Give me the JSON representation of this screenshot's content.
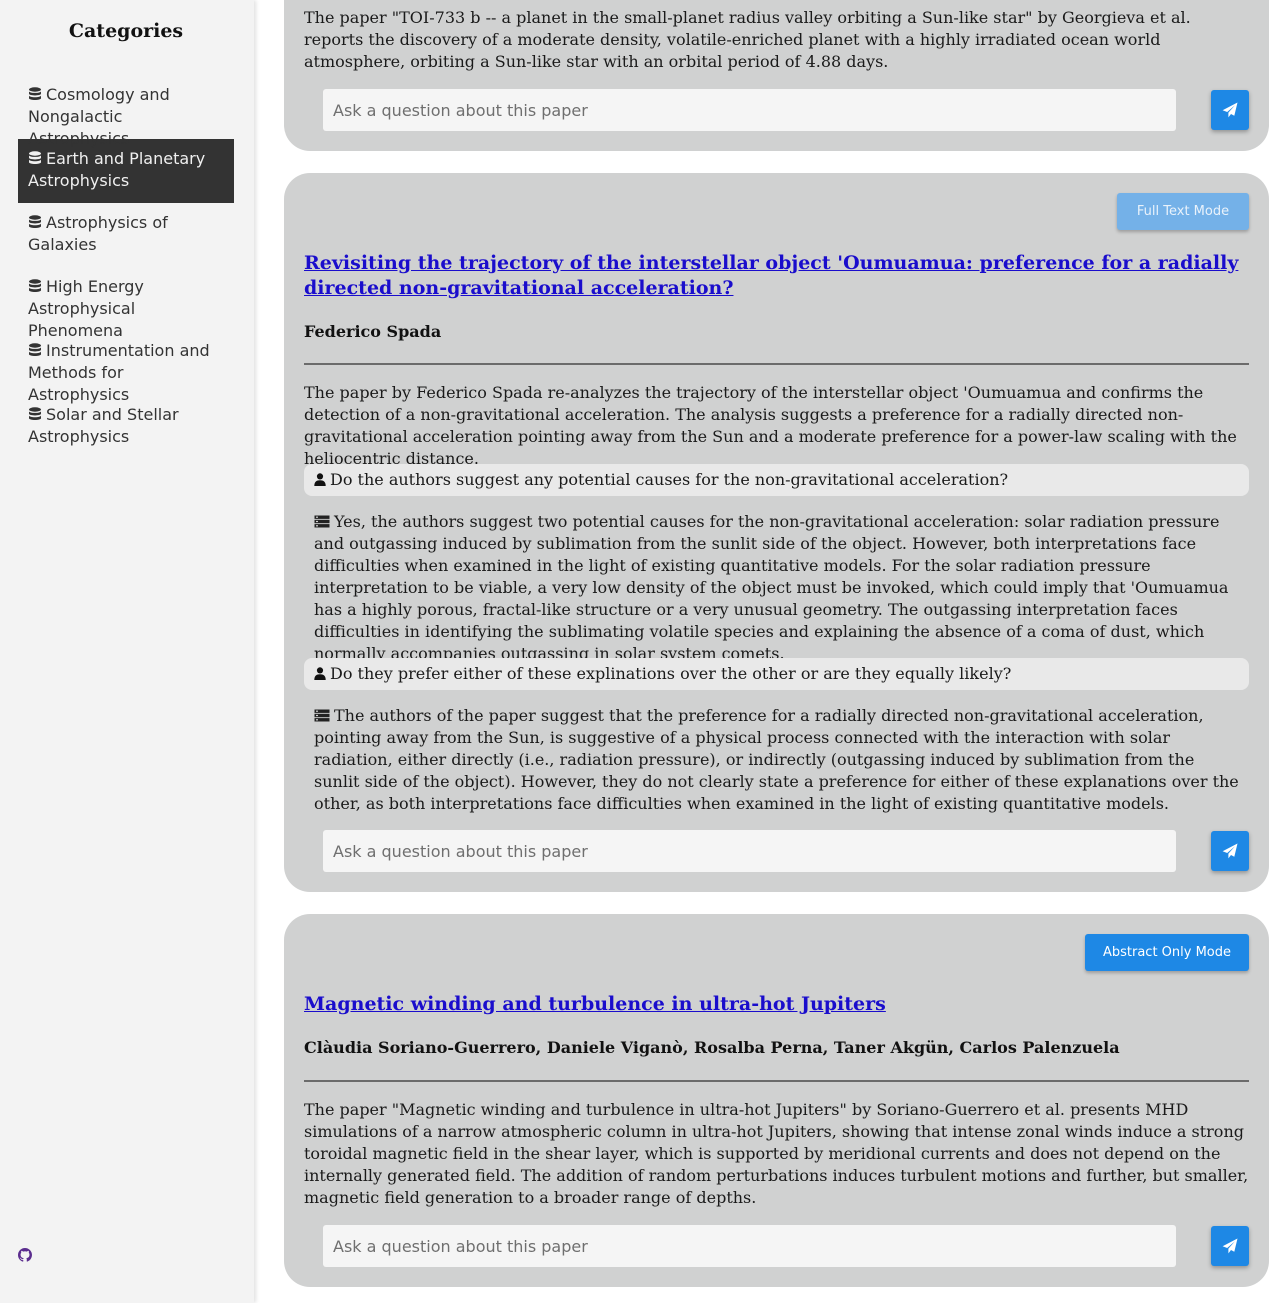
{
  "sidebar": {
    "title": "Categories",
    "items": [
      {
        "label": "Cosmology and Nongalactic Astrophysics",
        "active": false
      },
      {
        "label": "Earth and Planetary Astrophysics",
        "active": true
      },
      {
        "label": "Astrophysics of Galaxies",
        "active": false
      },
      {
        "label": "High Energy Astrophysical Phenomena",
        "active": false
      },
      {
        "label": "Instrumentation and Methods for Astrophysics",
        "active": false
      },
      {
        "label": "Solar and Stellar Astrophysics",
        "active": false
      }
    ],
    "footer_icon": "github-icon"
  },
  "papers": [
    {
      "summary": "The paper \"TOI-733 b -- a planet in the small-planet radius valley orbiting a Sun-like star\" by Georgieva et al. reports the discovery of a moderate density, volatile-enriched planet with a highly irradiated ocean world atmosphere, orbiting a Sun-like star with an orbital period of 4.88 days.",
      "ask_placeholder": "Ask a question about this paper"
    },
    {
      "mode_button": "Full Text Mode",
      "title": "Revisiting the trajectory of the interstellar object 'Oumuamua: preference for a radially directed non-gravitational acceleration?",
      "authors": "Federico Spada",
      "summary": "The paper by Federico Spada re-analyzes the trajectory of the interstellar object 'Oumuamua and confirms the detection of a non-gravitational acceleration. The analysis suggests a preference for a radially directed non-gravitational acceleration pointing away from the Sun and a moderate preference for a power-law scaling with the heliocentric distance.",
      "qa": [
        {
          "question": "Do the authors suggest any potential causes for the non-gravitational acceleration?",
          "answer": "Yes, the authors suggest two potential causes for the non-gravitational acceleration: solar radiation pressure and outgassing induced by sublimation from the sunlit side of the object. However, both interpretations face difficulties when examined in the light of existing quantitative models. For the solar radiation pressure interpretation to be viable, a very low density of the object must be invoked, which could imply that 'Oumuamua has a highly porous, fractal-like structure or a very unusual geometry. The outgassing interpretation faces difficulties in identifying the sublimating volatile species and explaining the absence of a coma of dust, which normally accompanies outgassing in solar system comets."
        },
        {
          "question": "Do they prefer either of these explinations over the other or are they equally likely?",
          "answer": "The authors of the paper suggest that the preference for a radially directed non-gravitational acceleration, pointing away from the Sun, is suggestive of a physical process connected with the interaction with solar radiation, either directly (i.e., radiation pressure), or indirectly (outgassing induced by sublimation from the sunlit side of the object). However, they do not clearly state a preference for either of these explanations over the other, as both interpretations face difficulties when examined in the light of existing quantitative models."
        }
      ],
      "ask_placeholder": "Ask a question about this paper"
    },
    {
      "mode_button": "Abstract Only Mode",
      "title": "Magnetic winding and turbulence in ultra-hot Jupiters",
      "authors": "Clàudia Soriano-Guerrero, Daniele Viganò, Rosalba Perna, Taner Akgün, Carlos Palenzuela",
      "summary": "The paper \"Magnetic winding and turbulence in ultra-hot Jupiters\" by Soriano-Guerrero et al. presents MHD simulations of a narrow atmospheric column in ultra-hot Jupiters, showing that intense zonal winds induce a strong toroidal magnetic field in the shear layer, which is supported by meridional currents and does not depend on the internally generated field. The addition of random perturbations induces turbulent motions and further, but smaller, magnetic field generation to a broader range of depths.",
      "ask_placeholder": "Ask a question about this paper"
    }
  ],
  "icons": {
    "category": "database-icon",
    "question": "user-icon",
    "answer": "server-icon",
    "send": "paper-plane-icon"
  },
  "colors": {
    "accent": "#1e88e5",
    "accent_disabled": "#74b1e8",
    "active_category_bg": "#333333",
    "card_bg": "#d0d1d1",
    "link": "#1a0dcc"
  }
}
